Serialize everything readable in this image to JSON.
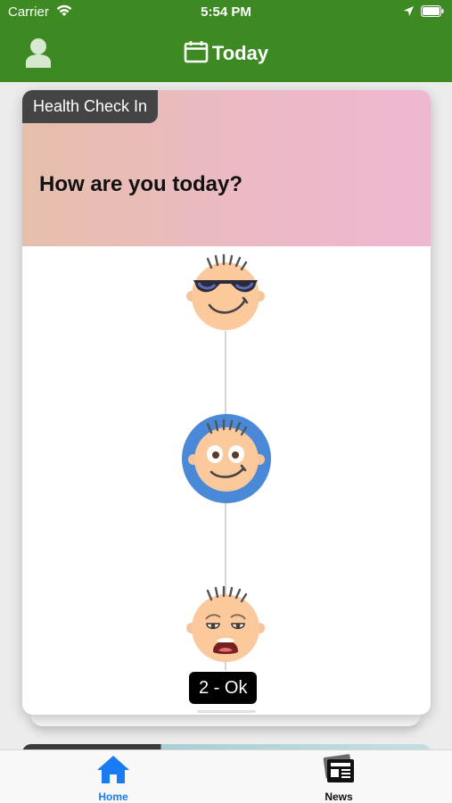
{
  "status_bar": {
    "carrier": "Carrier",
    "time": "5:54 PM"
  },
  "nav": {
    "title": "Today",
    "left_icon": "user-profile-icon",
    "title_icon": "calendar-icon"
  },
  "card": {
    "tag": "Health Check In",
    "question": "How are you today?",
    "value_label": "2 - Ok",
    "faces": [
      {
        "name": "cool-face-icon"
      },
      {
        "name": "ok-face-icon",
        "selected": true
      },
      {
        "name": "sad-face-icon"
      }
    ]
  },
  "tabbar": {
    "items": [
      {
        "label": "Home",
        "icon": "home-icon",
        "active": true
      },
      {
        "label": "News",
        "icon": "newspaper-icon",
        "active": false
      }
    ]
  },
  "colors": {
    "nav_bg": "#3e8a22",
    "active_tab": "#1a7cf5",
    "selected_ring": "#4a88d8"
  }
}
